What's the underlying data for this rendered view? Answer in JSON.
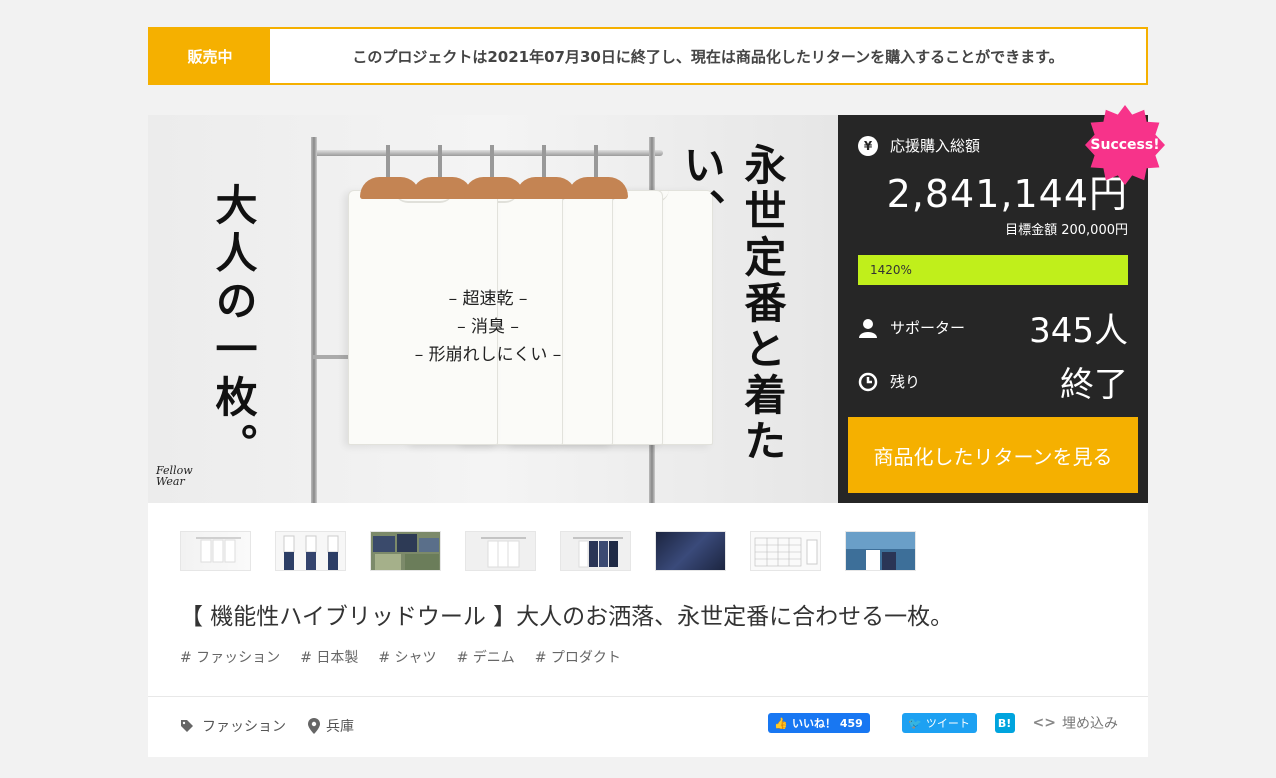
{
  "banner": {
    "status_label": "販売中",
    "message": "このプロジェクトは2021年07月30日に終了し、現在は商品化したリターンを購入することができます。"
  },
  "hero": {
    "left_text": "大人の一枚。",
    "right_text": "永世定番と着たい、",
    "center_lines": [
      "– 超速乾 –",
      "– 消臭 –",
      "– 形崩れしにくい –"
    ],
    "signature": "Fellow\nWear"
  },
  "stats": {
    "total_label": "応援購入総額",
    "total_icon": "yen-icon",
    "total_amount": "2,841,144円",
    "target_label": "目標金額 200,000円",
    "progress_text": "1420%",
    "progress_fraction": 1.0,
    "supporters_label": "サポーター",
    "supporters_value": "345人",
    "remaining_label": "残り",
    "remaining_value": "終了",
    "cta_label": "商品化したリターンを見る",
    "success_badge": "Success!"
  },
  "colors": {
    "accent": "#f5b000",
    "panel": "#262626",
    "progress": "#c0ef1b",
    "success": "#f7338a"
  },
  "thumbnails": [
    "thumb-rack-white",
    "thumb-models",
    "thumb-folded-shirts",
    "thumb-rack-white-2",
    "thumb-rack-navy",
    "thumb-fabric-navy",
    "thumb-size-chart",
    "thumb-seaside"
  ],
  "title": "【 機能性ハイブリッドウール 】大人のお洒落、永世定番に合わせる一枚。",
  "tags": [
    "# ファッション",
    "# 日本製",
    "# シャツ",
    "# デニム",
    "# プロダクト"
  ],
  "meta": {
    "category": "ファッション",
    "location": "兵庫"
  },
  "share": {
    "like_label": "いいね！ 459",
    "tweet_label": "ツイート",
    "hatena_label": "B!",
    "embed_label": "埋め込み"
  }
}
